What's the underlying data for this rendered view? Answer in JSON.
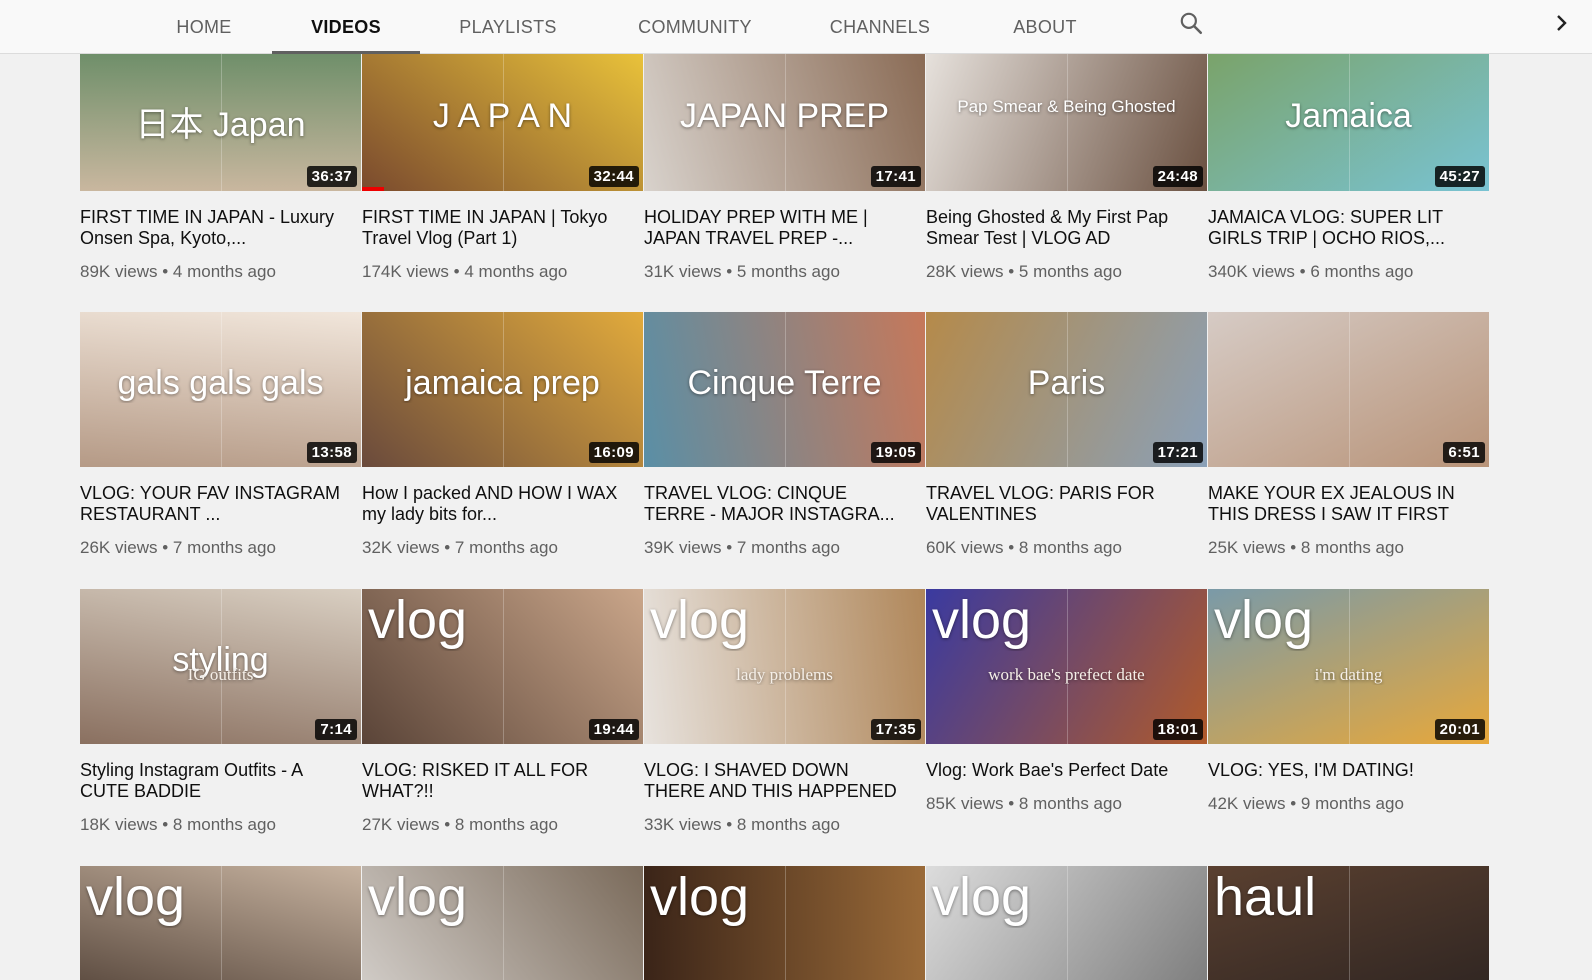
{
  "tabs": [
    {
      "label": "HOME",
      "active": false
    },
    {
      "label": "VIDEOS",
      "active": true
    },
    {
      "label": "PLAYLISTS",
      "active": false
    },
    {
      "label": "COMMUNITY",
      "active": false
    },
    {
      "label": "CHANNELS",
      "active": false
    },
    {
      "label": "ABOUT",
      "active": false
    }
  ],
  "icons": {
    "search": "search-icon",
    "next": "chevron-right-icon"
  },
  "videos": [
    {
      "title": "FIRST TIME IN JAPAN - Luxury Onsen Spa, Kyoto,...",
      "views": "89K views",
      "age": "4 months ago",
      "duration": "36:37",
      "thumb_text": "日本  Japan",
      "colors": [
        "#c9b79f",
        "#6f8f6a"
      ],
      "style": "japan1"
    },
    {
      "title": "FIRST TIME IN JAPAN | Tokyo Travel Vlog (Part 1)",
      "views": "174K views",
      "age": "4 months ago",
      "duration": "32:44",
      "thumb_text": "J A P A N",
      "colors": [
        "#7a4a2e",
        "#e9c23a"
      ],
      "style": "japan2",
      "progress": 0.08
    },
    {
      "title": "HOLIDAY PREP WITH ME | JAPAN TRAVEL PREP -...",
      "views": "31K views",
      "age": "5 months ago",
      "duration": "17:41",
      "thumb_text": "JAPAN PREP",
      "colors": [
        "#d8d2cc",
        "#8a6b55"
      ],
      "style": "prep"
    },
    {
      "title": "Being Ghosted & My First Pap Smear Test | VLOG AD",
      "views": "28K views",
      "age": "5 months ago",
      "duration": "24:48",
      "thumb_text": "Pap Smear & Being Ghosted",
      "colors": [
        "#e6e1dc",
        "#6a5040"
      ],
      "style": "pap"
    },
    {
      "title": "JAMAICA VLOG: SUPER LIT GIRLS TRIP | OCHO RIOS,...",
      "views": "340K views",
      "age": "6 months ago",
      "duration": "45:27",
      "thumb_text": "Jamaica",
      "colors": [
        "#7aa36a",
        "#79c3d3"
      ],
      "style": "jamaica"
    },
    {
      "title": "VLOG: YOUR FAV INSTAGRAM RESTAURANT ...",
      "views": "26K views",
      "age": "7 months ago",
      "duration": "13:58",
      "thumb_text": "gals gals gals",
      "colors": [
        "#b59a86",
        "#f1e6db"
      ],
      "style": "gals"
    },
    {
      "title": "How I packed AND HOW I WAX my lady bits for...",
      "views": "32K views",
      "age": "7 months ago",
      "duration": "16:09",
      "thumb_text": "jamaica prep",
      "colors": [
        "#6a4a3c",
        "#e2ab3c"
      ],
      "style": "jprep"
    },
    {
      "title": "TRAVEL VLOG: CINQUE TERRE - MAJOR INSTAGRA...",
      "views": "39K views",
      "age": "7 months ago",
      "duration": "19:05",
      "thumb_text": "Cinque Terre",
      "colors": [
        "#5a8fa6",
        "#c6785a"
      ],
      "style": "cinque"
    },
    {
      "title": "TRAVEL VLOG: PARIS FOR VALENTINES",
      "views": "60K views",
      "age": "8 months ago",
      "duration": "17:21",
      "thumb_text": "Paris",
      "colors": [
        "#b58a4a",
        "#8aa0b8"
      ],
      "style": "paris"
    },
    {
      "title": "MAKE YOUR EX JEALOUS IN THIS DRESS I SAW IT FIRST",
      "views": "25K views",
      "age": "8 months ago",
      "duration": "6:51",
      "thumb_text": "",
      "colors": [
        "#d6cbc5",
        "#b89378"
      ],
      "style": "dress"
    },
    {
      "title": "Styling Instagram Outfits - A CUTE BADDIE",
      "views": "18K views",
      "age": "8 months ago",
      "duration": "7:14",
      "thumb_text": "styling",
      "thumb_sub": "IG outfits",
      "colors": [
        "#8a7060",
        "#d9cfc2"
      ],
      "style": "styling"
    },
    {
      "title": "VLOG: RISKED IT ALL FOR WHAT?!!",
      "views": "27K views",
      "age": "8 months ago",
      "duration": "19:44",
      "thumb_text": "vlog",
      "colors": [
        "#5a4438",
        "#caa68a"
      ],
      "style": "vlog"
    },
    {
      "title": "VLOG: I SHAVED DOWN THERE AND THIS HAPPENED",
      "views": "33K views",
      "age": "8 months ago",
      "duration": "17:35",
      "thumb_text": "vlog",
      "thumb_sub": "lady problems",
      "colors": [
        "#e7e2dd",
        "#b0875a"
      ],
      "style": "vlogdark"
    },
    {
      "title": "Vlog: Work Bae's Perfect Date",
      "views": "85K views",
      "age": "8 months ago",
      "duration": "18:01",
      "thumb_text": "vlog",
      "thumb_sub": "work bae's prefect date",
      "colors": [
        "#3a3aa0",
        "#b05a2a"
      ],
      "style": "vlog",
      "short": true
    },
    {
      "title": "VLOG: YES, I'M DATING!",
      "views": "42K views",
      "age": "9 months ago",
      "duration": "20:01",
      "thumb_text": "vlog",
      "thumb_sub": "i'm dating",
      "colors": [
        "#7a9aa8",
        "#e8a83a"
      ],
      "style": "vlogdark",
      "short": true
    },
    {
      "title": "",
      "views": "",
      "age": "",
      "duration": "",
      "thumb_text": "vlog",
      "colors": [
        "#4a3a30",
        "#c7b3a0"
      ],
      "style": "vlog"
    },
    {
      "title": "",
      "views": "",
      "age": "",
      "duration": "",
      "thumb_text": "vlog",
      "colors": [
        "#d7d3cf",
        "#7a6a5a"
      ],
      "style": "vlog"
    },
    {
      "title": "",
      "views": "",
      "age": "",
      "duration": "",
      "thumb_text": "vlog",
      "colors": [
        "#3a2418",
        "#9a6a38"
      ],
      "style": "vlog"
    },
    {
      "title": "",
      "views": "",
      "age": "",
      "duration": "",
      "thumb_text": "vlog",
      "colors": [
        "#dcdcdc",
        "#777"
      ],
      "style": "vlog"
    },
    {
      "title": "",
      "views": "",
      "age": "",
      "duration": "",
      "thumb_text": "haul",
      "colors": [
        "#5a4030",
        "#2a2220"
      ],
      "style": "vlog"
    }
  ]
}
